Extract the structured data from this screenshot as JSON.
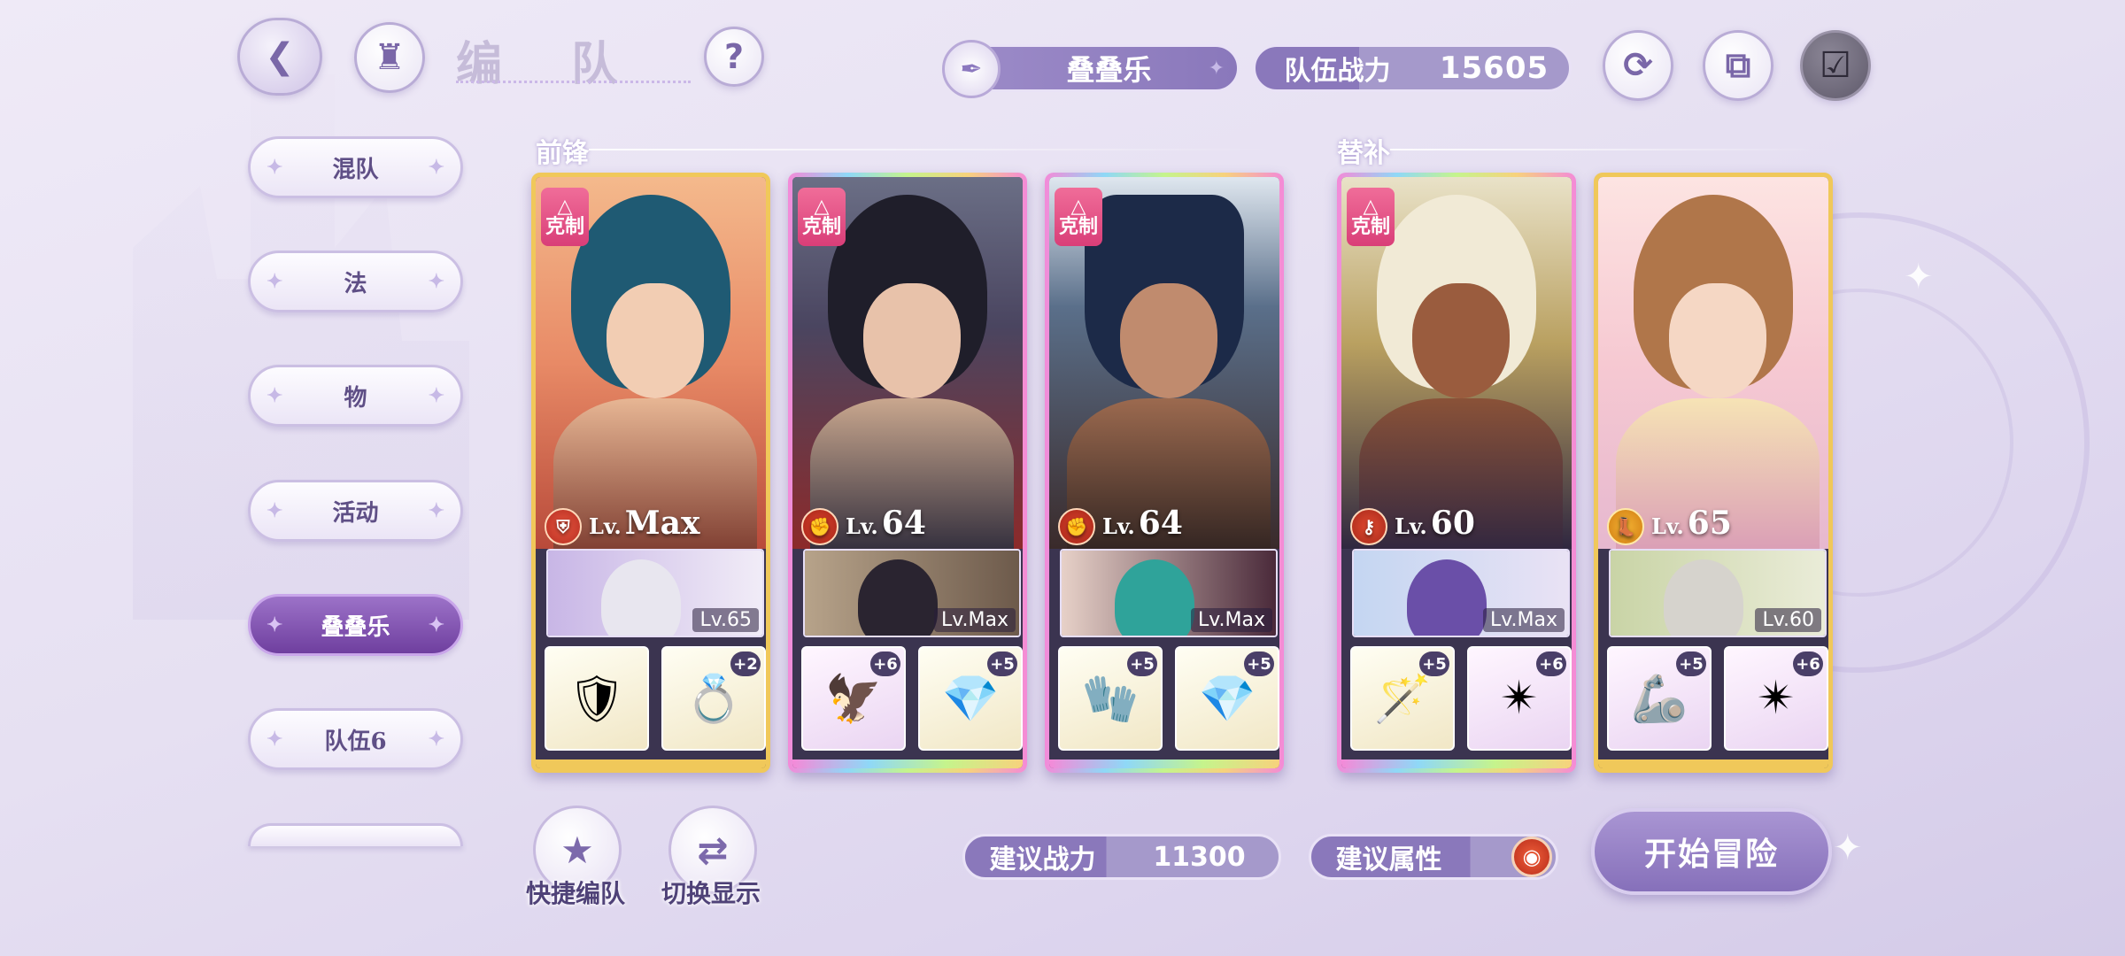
{
  "header": {
    "title": "编 队",
    "team_name": "叠叠乐",
    "team_power_label": "队伍战力",
    "team_power_value": "15605",
    "icons": [
      "back-icon",
      "castle-home-icon",
      "help-icon",
      "refresh-icon",
      "copy-icon",
      "checklist-icon"
    ],
    "help_glyph": "?"
  },
  "sidebar": {
    "tabs": [
      {
        "label": "混队",
        "active": false
      },
      {
        "label": "法",
        "active": false
      },
      {
        "label": "物",
        "active": false
      },
      {
        "label": "活动",
        "active": false
      },
      {
        "label": "叠叠乐",
        "active": true
      },
      {
        "label": "队伍6",
        "active": false
      }
    ]
  },
  "sections": {
    "front": "前锋",
    "sub": "替补"
  },
  "cards": [
    {
      "counter": "克制",
      "level_prefix": "Lv.",
      "level": "Max",
      "element": "shield",
      "partner_level": "Lv.65",
      "equip": [
        {
          "icon": "gauntlet-icon",
          "plus": ""
        },
        {
          "icon": "ring-icon",
          "plus": "+2"
        }
      ]
    },
    {
      "counter": "克制",
      "level_prefix": "Lv.",
      "level": "64",
      "element": "fist",
      "partner_level": "Lv.Max",
      "equip": [
        {
          "icon": "gauntlet-icon",
          "plus": "+6"
        },
        {
          "icon": "gem-earring-icon",
          "plus": "+5"
        }
      ]
    },
    {
      "counter": "克制",
      "level_prefix": "Lv.",
      "level": "64",
      "element": "fist",
      "partner_level": "Lv.Max",
      "equip": [
        {
          "icon": "glove-icon",
          "plus": "+5"
        },
        {
          "icon": "gem-earring-icon",
          "plus": "+5"
        }
      ]
    },
    {
      "counter": "克制",
      "level_prefix": "Lv.",
      "level": "60",
      "element": "key",
      "partner_level": "Lv.Max",
      "equip": [
        {
          "icon": "wand-icon",
          "plus": "+5"
        },
        {
          "icon": "star-earring-icon",
          "plus": "+6"
        }
      ]
    },
    {
      "counter": "",
      "level_prefix": "Lv.",
      "level": "65",
      "element": "gold",
      "partner_level": "Lv.60",
      "equip": [
        {
          "icon": "gauntlet-icon",
          "plus": "+5"
        },
        {
          "icon": "star-earring-icon",
          "plus": "+6"
        }
      ]
    }
  ],
  "bottom": {
    "quick_team_label": "快捷编队",
    "switch_display_label": "切换显示",
    "suggest_power_label": "建议战力",
    "suggest_power_value": "11300",
    "suggest_attr_label": "建议属性",
    "start_label": "开始冒险"
  }
}
